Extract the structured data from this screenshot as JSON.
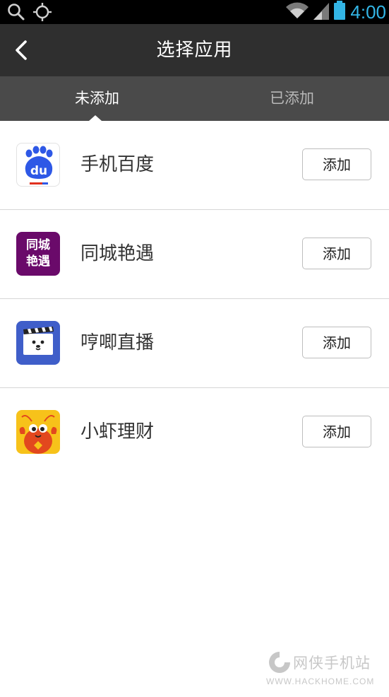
{
  "statusbar": {
    "time": "4:00",
    "icons": [
      "search-icon",
      "gps-icon",
      "wifi-icon",
      "signal-icon",
      "battery-icon"
    ]
  },
  "header": {
    "title": "选择应用",
    "back_icon": "chevron-left-icon"
  },
  "tabs": [
    {
      "label": "未添加",
      "active": true
    },
    {
      "label": "已添加",
      "active": false
    }
  ],
  "apps": [
    {
      "name": "手机百度",
      "action": "添加",
      "icon": "baidu-icon"
    },
    {
      "name": "同城艳遇",
      "action": "添加",
      "icon": "tongcheng-yanyu-icon",
      "icon_text": [
        "同城",
        "艳遇"
      ]
    },
    {
      "name": "哼唧直播",
      "action": "添加",
      "icon": "hengji-live-icon"
    },
    {
      "name": "小虾理财",
      "action": "添加",
      "icon": "xiaoxia-finance-icon"
    }
  ],
  "watermark": {
    "text": "网侠手机站",
    "url": "WWW.HACKHOME.COM"
  },
  "colors": {
    "status_accent": "#33b5e5",
    "titlebar_bg": "#2f2f2f",
    "tabbar_bg": "#4a4a4a",
    "divider": "#d6d6d6"
  }
}
